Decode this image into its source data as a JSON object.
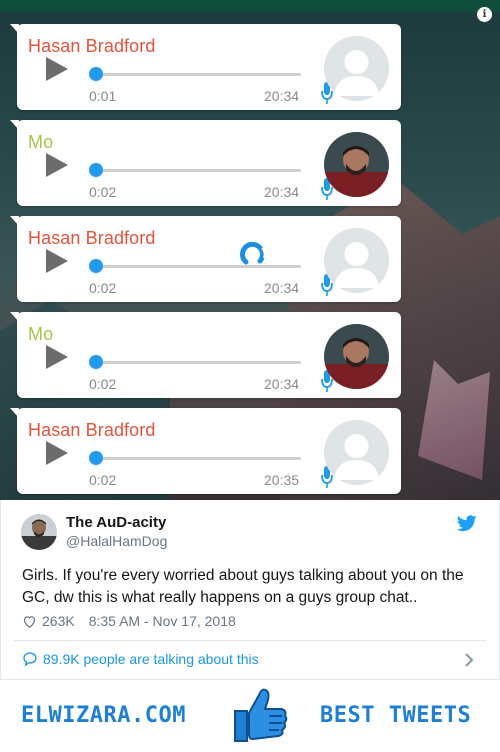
{
  "media": {
    "messages": [
      {
        "sender": "Hasan Bradford",
        "sender_color": "#e0533d",
        "duration": "0:01",
        "time": "20:34",
        "avatar": "default-avatar"
      },
      {
        "sender": "Mo",
        "sender_color": "#a8c34a",
        "duration": "0:02",
        "time": "20:34",
        "avatar": "photo-avatar"
      },
      {
        "sender": "Hasan Bradford",
        "sender_color": "#e0533d",
        "duration": "0:02",
        "time": "20:34",
        "avatar": "default-avatar"
      },
      {
        "sender": "Mo",
        "sender_color": "#a8c34a",
        "duration": "0:02",
        "time": "20:34",
        "avatar": "photo-avatar"
      },
      {
        "sender": "Hasan Bradford",
        "sender_color": "#e0533d",
        "duration": "0:02",
        "time": "20:35",
        "avatar": "default-avatar"
      }
    ]
  },
  "tweet": {
    "display_name": "The AuD-acity",
    "handle": "@HalalHamDog",
    "text": "Girls. If you're every worried about guys talking about you on the GC, dw this is what really happens on a guys group chat..",
    "likes": "263K",
    "timestamp": "8:35 AM - Nov 17, 2018",
    "talking": "89.9K people are talking about this",
    "accent_color": "#1da1f2"
  },
  "banner": {
    "brand": "ELWIZARA.COM",
    "tagline": "BEST TWEETS",
    "brand_color": "#1f7fd2"
  }
}
